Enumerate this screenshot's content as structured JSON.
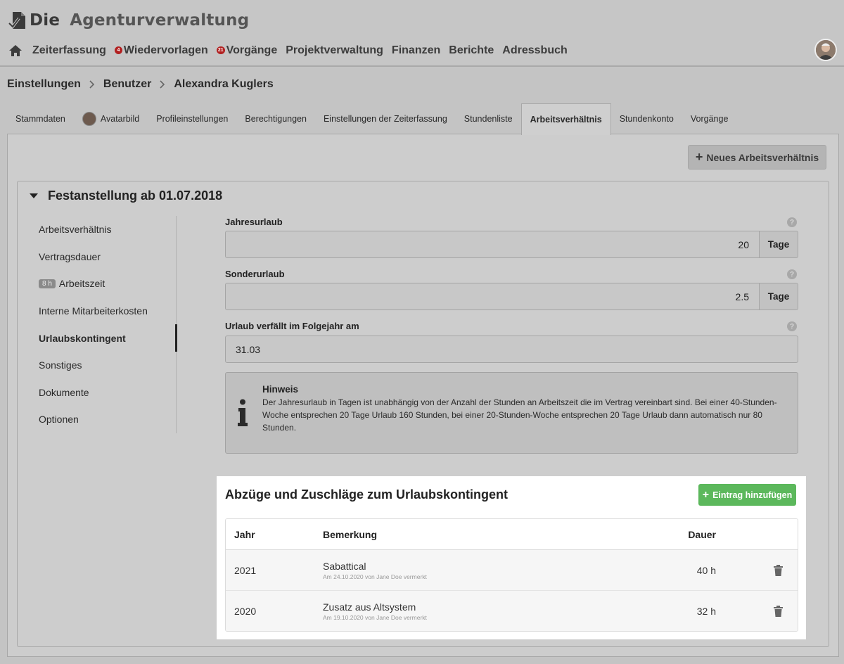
{
  "app": {
    "logo_die": "Die",
    "logo_name": "Agenturverwaltung"
  },
  "nav": [
    {
      "label": "Zeiterfassung",
      "badge": ""
    },
    {
      "label": "Wiedervorlagen",
      "badge": "4"
    },
    {
      "label": "Vorgänge",
      "badge": "21"
    },
    {
      "label": "Projektverwaltung",
      "badge": ""
    },
    {
      "label": "Finanzen",
      "badge": ""
    },
    {
      "label": "Berichte",
      "badge": ""
    },
    {
      "label": "Adressbuch",
      "badge": ""
    }
  ],
  "breadcrumb": [
    "Einstellungen",
    "Benutzer",
    "Alexandra Kuglers"
  ],
  "tabs": [
    {
      "label": "Stammdaten"
    },
    {
      "label": "Avatarbild"
    },
    {
      "label": "Profileinstellungen"
    },
    {
      "label": "Berechtigungen"
    },
    {
      "label": "Einstellungen der Zeiterfassung"
    },
    {
      "label": "Stundenliste"
    },
    {
      "label": "Arbeitsverhältnis"
    },
    {
      "label": "Stundenkonto"
    },
    {
      "label": "Vorgänge"
    }
  ],
  "new_button": "Neues Arbeitsverhältnis",
  "card_title": "Festanstellung ab 01.07.2018",
  "sidenav": [
    {
      "label": "Arbeitsverhältnis",
      "badge": ""
    },
    {
      "label": "Vertragsdauer",
      "badge": ""
    },
    {
      "label": "Arbeitszeit",
      "badge": "8 h"
    },
    {
      "label": "Interne Mitarbeiterkosten",
      "badge": ""
    },
    {
      "label": "Urlaubskontingent",
      "badge": ""
    },
    {
      "label": "Sonstiges",
      "badge": ""
    },
    {
      "label": "Dokumente",
      "badge": ""
    },
    {
      "label": "Optionen",
      "badge": ""
    }
  ],
  "fields": {
    "jahresurlaub": {
      "label": "Jahresurlaub",
      "value": "20",
      "unit": "Tage"
    },
    "sonderurlaub": {
      "label": "Sonderurlaub",
      "value": "2.5",
      "unit": "Tage"
    },
    "verfall": {
      "label": "Urlaub verfällt im Folgejahr am",
      "value": "31.03"
    },
    "help": "?"
  },
  "hint": {
    "title": "Hinweis",
    "text": "Der Jahresurlaub in Tagen ist unabhängig von der Anzahl der Stunden an Arbeitszeit die im Vertrag vereinbart sind. Bei einer 40-Stunden-Woche entsprechen 20 Tage Urlaub 160 Stunden, bei einer 20-Stunden-Woche entsprechen 20 Tage Urlaub dann automatisch nur 80 Stunden."
  },
  "adjustments": {
    "title": "Abzüge und Zuschläge zum Urlaubskontingent",
    "add_button": "Eintrag hinzufügen",
    "columns": {
      "year": "Jahr",
      "remark": "Bemerkung",
      "duration": "Dauer"
    },
    "rows": [
      {
        "year": "2021",
        "remark": "Sabattical",
        "note": "Am 24.10.2020 von Jane Doe vermerkt",
        "duration": "40 h"
      },
      {
        "year": "2020",
        "remark": "Zusatz aus Altsystem",
        "note": "Am 19.10.2020 von Jane Doe vermerkt",
        "duration": "32 h"
      }
    ]
  },
  "colors": {
    "accent_green": "#5cb85c",
    "badge_red": "#b22020"
  }
}
